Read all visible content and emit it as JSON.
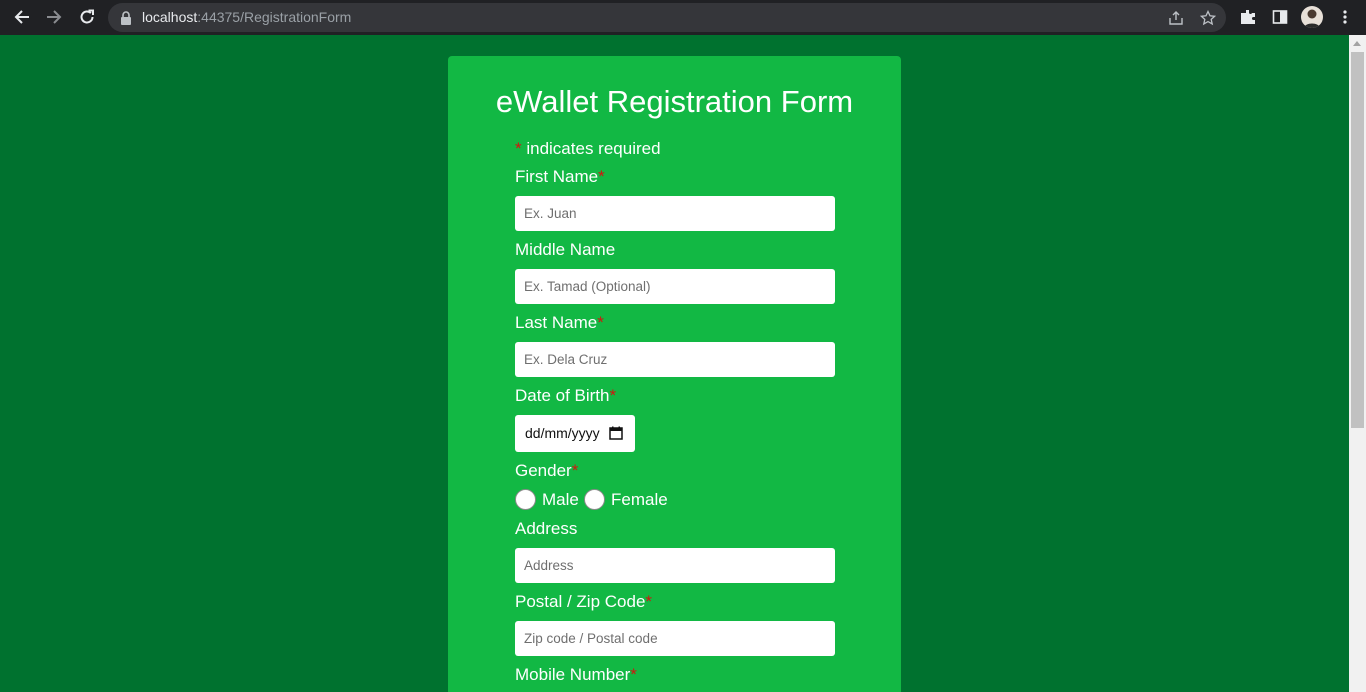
{
  "browser": {
    "url_host": "localhost",
    "url_path": ":44375/RegistrationForm"
  },
  "form": {
    "title": "eWallet Registration Form",
    "required_note": {
      "asterisk": "*",
      "text": " indicates required"
    },
    "fields": {
      "first_name": {
        "label": "First Name",
        "required_mark": "*",
        "placeholder": "Ex. Juan"
      },
      "middle_name": {
        "label": "Middle Name",
        "placeholder": "Ex. Tamad (Optional)"
      },
      "last_name": {
        "label": "Last Name",
        "required_mark": "*",
        "placeholder": "Ex. Dela Cruz"
      },
      "dob": {
        "label": "Date of Birth",
        "required_mark": "*",
        "format": "dd/mm/yyyy"
      },
      "gender": {
        "label": "Gender",
        "required_mark": "*",
        "options": [
          "Male",
          "Female"
        ]
      },
      "address": {
        "label": "Address",
        "placeholder": "Address"
      },
      "postal": {
        "label": "Postal / Zip Code",
        "required_mark": "*",
        "placeholder": "Zip code / Postal code"
      },
      "mobile": {
        "label": "Mobile Number",
        "required_mark": "*"
      }
    }
  },
  "colors": {
    "page_bg": "#00722f",
    "card_bg": "#12b844",
    "required": "#d4140e"
  }
}
